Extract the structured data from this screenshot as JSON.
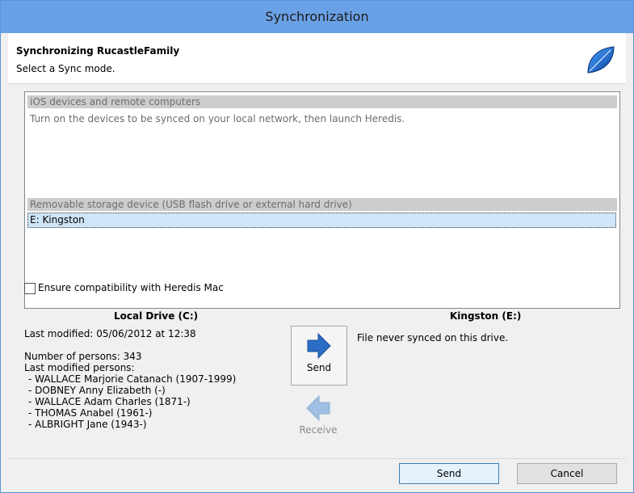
{
  "window": {
    "title": "Synchronization"
  },
  "header": {
    "title": "Synchronizing RucastleFamily",
    "subtitle": "Select a Sync mode."
  },
  "list": {
    "group1_header": "iOS devices and remote computers",
    "group1_desc": "Turn on the devices to be synced on your local network, then launch Heredis.",
    "group2_header": "Removable storage device (USB flash drive or external hard drive)",
    "selected_item": "E: Kingston"
  },
  "compat": {
    "label": "Ensure compatibility with Heredis Mac",
    "checked": false
  },
  "local": {
    "title": "Local Drive (C:)",
    "last_modified": "Last modified: 05/06/2012 at 12:38",
    "num_persons": "Number of persons: 343",
    "last_modified_persons_label": "Last modified persons:",
    "persons": [
      "- WALLACE Marjorie Catanach (1907-1999)",
      "- DOBNEY Anny Elizabeth (-)",
      "- WALLACE Adam Charles (1871-)",
      "- THOMAS Anabel (1961-)",
      "- ALBRIGHT Jane (1943-)"
    ]
  },
  "remote": {
    "title": "Kingston (E:)",
    "status": "File never synced on this drive."
  },
  "actions": {
    "send_big_label": "Send",
    "receive_big_label": "Receive",
    "send_button": "Send",
    "cancel_button": "Cancel"
  },
  "colors": {
    "titlebar": "#6aa1e6",
    "arrow_active": "#2b6cc4",
    "arrow_disabled": "#9fbfe3",
    "selection": "#cfe5f8"
  },
  "icons": {
    "app_logo": "leaf-logo-icon",
    "send": "arrow-right-icon",
    "receive": "arrow-left-icon"
  }
}
